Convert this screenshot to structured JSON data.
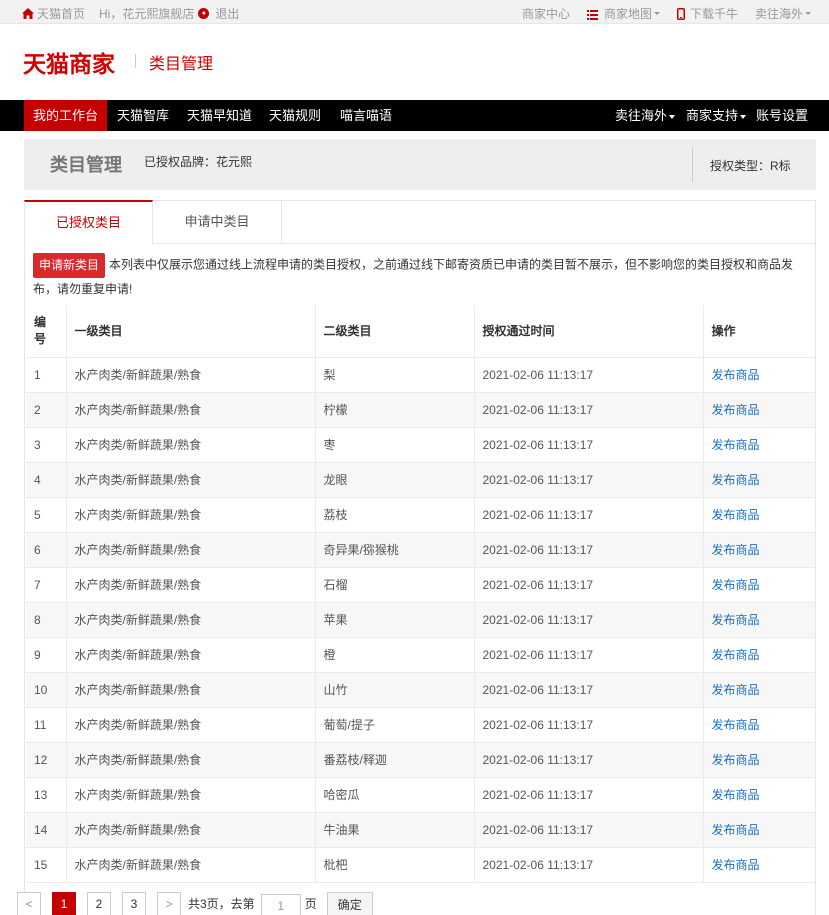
{
  "topbar": {
    "home": "天猫首页",
    "greeting": "Hi，花元熙旗舰店",
    "logout": "退出",
    "merchant_center": "商家中心",
    "merchant_map": "商家地图",
    "download": "下载千牛",
    "overseas": "卖往海外"
  },
  "header": {
    "logo": "天猫商家",
    "subtitle": "类目管理"
  },
  "nav": {
    "left": [
      "我的工作台",
      "天猫智库",
      "天猫早知道",
      "天猫规则",
      "喵言喵语"
    ],
    "right": [
      "卖往海外",
      "商家支持",
      "账号设置"
    ]
  },
  "titlebar": {
    "title": "类目管理",
    "brand": "已授权品牌：花元熙",
    "auth_type": "授权类型：R标"
  },
  "tabs": [
    "已授权类目",
    "申请中类目"
  ],
  "notice": {
    "button": "申请新类目",
    "text": "本列表中仅展示您通过线上流程申请的类目授权，之前通过线下邮寄资质已申请的类目暂不展示，但不影响您的类目授权和商品发布，请勿重复申请!"
  },
  "table": {
    "headers": [
      "编号",
      "一级类目",
      "二级类目",
      "授权通过时间",
      "操作"
    ],
    "rows": [
      [
        "1",
        "水产肉类/新鲜蔬果/熟食",
        "梨",
        "2021-02-06 11:13:17",
        "发布商品"
      ],
      [
        "2",
        "水产肉类/新鲜蔬果/熟食",
        "柠檬",
        "2021-02-06 11:13:17",
        "发布商品"
      ],
      [
        "3",
        "水产肉类/新鲜蔬果/熟食",
        "枣",
        "2021-02-06 11:13:17",
        "发布商品"
      ],
      [
        "4",
        "水产肉类/新鲜蔬果/熟食",
        "龙眼",
        "2021-02-06 11:13:17",
        "发布商品"
      ],
      [
        "5",
        "水产肉类/新鲜蔬果/熟食",
        "荔枝",
        "2021-02-06 11:13:17",
        "发布商品"
      ],
      [
        "6",
        "水产肉类/新鲜蔬果/熟食",
        "奇异果/猕猴桃",
        "2021-02-06 11:13:17",
        "发布商品"
      ],
      [
        "7",
        "水产肉类/新鲜蔬果/熟食",
        "石榴",
        "2021-02-06 11:13:17",
        "发布商品"
      ],
      [
        "8",
        "水产肉类/新鲜蔬果/熟食",
        "苹果",
        "2021-02-06 11:13:17",
        "发布商品"
      ],
      [
        "9",
        "水产肉类/新鲜蔬果/熟食",
        "橙",
        "2021-02-06 11:13:17",
        "发布商品"
      ],
      [
        "10",
        "水产肉类/新鲜蔬果/熟食",
        "山竹",
        "2021-02-06 11:13:17",
        "发布商品"
      ],
      [
        "11",
        "水产肉类/新鲜蔬果/熟食",
        "葡萄/提子",
        "2021-02-06 11:13:17",
        "发布商品"
      ],
      [
        "12",
        "水产肉类/新鲜蔬果/熟食",
        "番荔枝/释迦",
        "2021-02-06 11:13:17",
        "发布商品"
      ],
      [
        "13",
        "水产肉类/新鲜蔬果/熟食",
        "哈密瓜",
        "2021-02-06 11:13:17",
        "发布商品"
      ],
      [
        "14",
        "水产肉类/新鲜蔬果/熟食",
        "牛油果",
        "2021-02-06 11:13:17",
        "发布商品"
      ],
      [
        "15",
        "水产肉类/新鲜蔬果/熟食",
        "枇杷",
        "2021-02-06 11:13:17",
        "发布商品"
      ]
    ]
  },
  "pager": {
    "prev": "<",
    "pages": [
      "1",
      "2",
      "3"
    ],
    "next": ">",
    "total": "共3页，去第",
    "input_value": "1",
    "page_suffix": "页",
    "confirm": "确定"
  },
  "colors": {
    "brand_red": "#c40000",
    "link_blue": "#1a6fc4"
  }
}
